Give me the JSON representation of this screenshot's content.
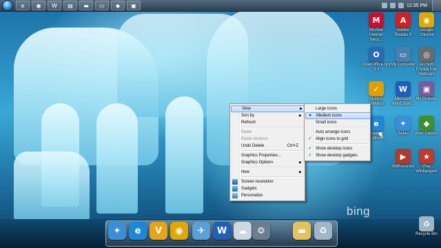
{
  "taskbar": {
    "clock": "12:35 PM",
    "items": [
      "orb",
      "ie",
      "chrome",
      "word",
      "explorer",
      "folder",
      "window",
      "gadget",
      "app"
    ]
  },
  "desktop_icons": [
    {
      "label": "McAfee Internet Secu...",
      "icon": "mcafee-icon",
      "color": "#c8102e",
      "glyph": "M"
    },
    {
      "label": "Adobe Reader 9",
      "icon": "adobe-reader-icon",
      "color": "#d21f1f",
      "glyph": "A"
    },
    {
      "label": "Google Chrome",
      "icon": "chrome-icon",
      "color": "#e0a800",
      "glyph": "◉"
    },
    {
      "label": "OpenOffice.org 3.3",
      "icon": "openoffice-icon",
      "color": "#2b6cb0",
      "glyph": "O"
    },
    {
      "label": "My Computer",
      "icon": "computer-icon",
      "color": "#4a7fb0",
      "glyph": "▭"
    },
    {
      "label": "ArcSoft Crystal Eye Webcam",
      "icon": "webcam-icon",
      "color": "#6a6a6a",
      "glyph": "◎"
    },
    {
      "label": "Norton Antivirus",
      "icon": "norton-icon",
      "color": "#e0a000",
      "glyph": "✓"
    },
    {
      "label": "Microsoft Word Start...",
      "icon": "word-icon",
      "color": "#1f5fb8",
      "glyph": "W"
    },
    {
      "label": "My Pictures",
      "icon": "pictures-icon",
      "color": "#7a5a9a",
      "glyph": "▣"
    },
    {
      "label": "Internet Explorer",
      "icon": "ie-icon",
      "color": "#1e88d6",
      "glyph": "e"
    },
    {
      "label": "Safari",
      "icon": "safari-icon",
      "color": "#3a8fd8",
      "glyph": "✦"
    },
    {
      "label": "Acer Games",
      "icon": "acer-games-icon",
      "color": "#3f8f2f",
      "glyph": "◆"
    },
    {
      "label": "SMRecorder",
      "icon": "smrecorder-icon",
      "color": "#b03a2e",
      "glyph": "▶"
    },
    {
      "label": "Play Wildtangent",
      "icon": "wildtangent-icon",
      "color": "#c0392b",
      "glyph": "★"
    },
    {
      "label": "Recycle Bin",
      "icon": "recycle-bin-icon",
      "color": "#9fb5c8",
      "glyph": "♻"
    }
  ],
  "context_menu": {
    "items": [
      {
        "label": "View",
        "submenu": true,
        "highlighted": true
      },
      {
        "label": "Sort by",
        "submenu": true
      },
      {
        "label": "Refresh"
      },
      {
        "label": "Paste",
        "disabled": true
      },
      {
        "label": "Paste shortcut",
        "disabled": true
      },
      {
        "label": "Undo Delete",
        "shortcut": "Ctrl+Z"
      },
      {
        "label": "Graphics Properties..."
      },
      {
        "label": "Graphics Options",
        "submenu": true
      },
      {
        "label": "New",
        "submenu": true
      },
      {
        "label": "Screen resolution",
        "icon": "screen-resolution-icon"
      },
      {
        "label": "Gadgets",
        "icon": "gadgets-icon"
      },
      {
        "label": "Personalize",
        "icon": "personalize-icon"
      }
    ]
  },
  "view_submenu": {
    "items": [
      {
        "label": "Large icons"
      },
      {
        "label": "Medium icons",
        "mark": "●",
        "highlighted": true
      },
      {
        "label": "Small icons"
      },
      {
        "label": "Auto arrange icons"
      },
      {
        "label": "Align icons to grid",
        "mark": "✓"
      },
      {
        "label": "Show desktop icons",
        "mark": "✓"
      },
      {
        "label": "Show desktop gadgets",
        "mark": "✓"
      }
    ]
  },
  "dock_items": [
    {
      "name": "safari-dock-icon",
      "color": "#3a8fd8",
      "glyph": "✦"
    },
    {
      "name": "ie-dock-icon",
      "color": "#1e88d6",
      "glyph": "e"
    },
    {
      "name": "vlc-dock-icon",
      "color": "#e8a317",
      "glyph": "V"
    },
    {
      "name": "chrome-dock-icon",
      "color": "#e0a800",
      "glyph": "◉"
    },
    {
      "name": "mail-dock-icon",
      "color": "#5a9fd6",
      "glyph": "✈"
    },
    {
      "name": "word-dock-icon",
      "color": "#1f5fb8",
      "glyph": "W"
    },
    {
      "name": "weather-dock-icon",
      "color": "#cfd8e0",
      "glyph": "☁"
    },
    {
      "name": "settings-dock-icon",
      "color": "#6b7d8f",
      "glyph": "⚙"
    },
    {
      "name": "folder-dock-icon",
      "color": "#e6c35a",
      "glyph": "▬"
    },
    {
      "name": "recycle-dock-icon",
      "color": "#9fb5c8",
      "glyph": "♻"
    }
  ],
  "watermark": "bing"
}
